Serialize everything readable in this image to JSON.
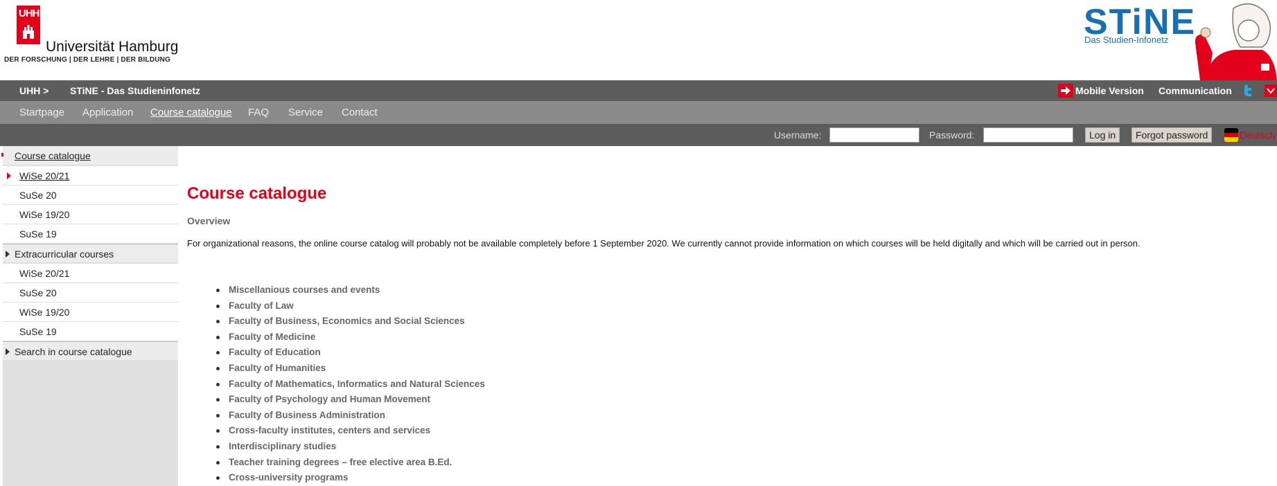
{
  "header": {
    "uhh_logo_text": "UHH",
    "university_name": "Universität Hamburg",
    "tagline": "DER FORSCHUNG | DER LEHRE | DER BILDUNG",
    "stine_logo_word": "STiNE",
    "stine_subtitle": "Das Studien-Infonetz"
  },
  "top_bar": {
    "crumb_uhh": "UHH >",
    "crumb_stine": "STiNE - Das Studieninfonetz",
    "mobile_version": "Mobile Version",
    "communication": "Communication"
  },
  "nav": {
    "items": [
      "Startpage",
      "Application",
      "Course catalogue",
      "FAQ",
      "Service",
      "Contact"
    ],
    "active": "Course catalogue"
  },
  "login": {
    "username_label": "Username:",
    "password_label": "Password:",
    "login_button": "Log in",
    "forgot_button": "Forgot password",
    "language": "Deutsch"
  },
  "sidebar": {
    "items": [
      "Course catalogue",
      "WiSe 20/21",
      "SuSe 20",
      "WiSe 19/20",
      "SuSe 19",
      "Extracurricular courses",
      "WiSe 20/21",
      "SuSe 20",
      "WiSe 19/20",
      "SuSe 19",
      "Search in course catalogue"
    ]
  },
  "main": {
    "title": "Course catalogue",
    "overview": "Overview",
    "intro": "For organizational reasons, the online course catalog will probably not be available completely before 1 September 2020. We currently cannot provide information on which courses will be held digitally and which will be carried out in person.",
    "faculties": [
      "Miscellanious courses and events",
      "Faculty of Law",
      "Faculty of Business, Economics and Social Sciences",
      "Faculty of Medicine",
      "Faculty of Education",
      "Faculty of Humanities",
      "Faculty of Mathematics, Informatics and Natural Sciences",
      "Faculty of Psychology and Human Movement",
      "Faculty of Business Administration",
      "Cross-faculty institutes, centers and services",
      "Interdisciplinary studies",
      "Teacher training degrees – free elective area B.Ed.",
      "Cross-university programs"
    ]
  },
  "colors": {
    "brand_red": "#e2001a",
    "stine_blue": "#1a6fb4",
    "bar_dark": "#5d5d5d",
    "bar_mid": "#8a8a8a"
  }
}
